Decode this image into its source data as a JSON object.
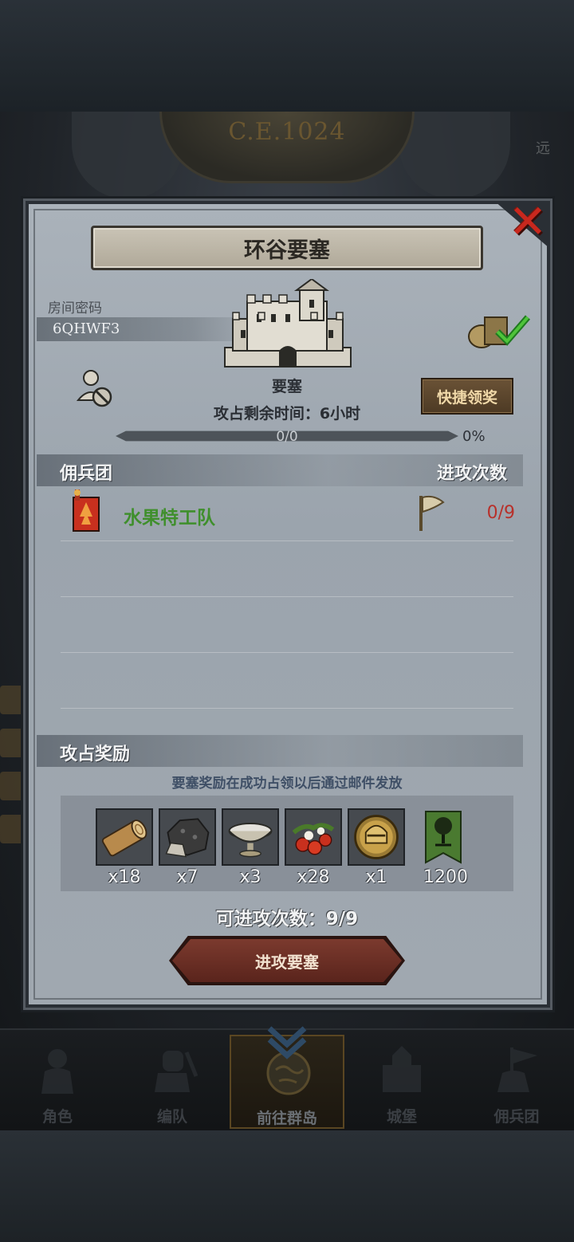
{
  "background": {
    "year_label": "C.E.1024",
    "right_edge_text": "远"
  },
  "dialog": {
    "title": "环谷要塞",
    "room_label": "房间密码",
    "room_code": "6QHWF3",
    "fortress_label": "要塞",
    "quick_claim_label": "快捷领奖",
    "time_left_text": "攻占剩余时间：6小时",
    "progress": {
      "count_text": "0/0",
      "percent_text": "0%",
      "fraction": 0
    },
    "mercenary_header": "佣兵团",
    "attack_count_header": "进攻次数",
    "mercenary_rows": [
      {
        "name": "水果特工队",
        "attacks": "0/9"
      }
    ],
    "rewards_header": "攻占奖励",
    "reward_note": "要塞奖励在成功占领以后通过邮件发放",
    "rewards": [
      {
        "icon": "wood-log-icon",
        "qty": "x18"
      },
      {
        "icon": "ore-stone-icon",
        "qty": "x7"
      },
      {
        "icon": "silver-bowl-icon",
        "qty": "x3"
      },
      {
        "icon": "berries-icon",
        "qty": "x28"
      },
      {
        "icon": "knight-helmet-coin-icon",
        "qty": "x1"
      },
      {
        "icon": "tree-banner-icon",
        "qty": "1200"
      }
    ],
    "attacks_available_text": "可进攻次数：9/9",
    "attack_button_label": "进攻要塞"
  },
  "bottom_nav": [
    {
      "label": "角色",
      "icon": "knight-icon",
      "active": false
    },
    {
      "label": "编队",
      "icon": "formation-icon",
      "active": false
    },
    {
      "label": "前往群岛",
      "icon": "globe-icon",
      "active": true
    },
    {
      "label": "城堡",
      "icon": "castle-icon",
      "active": false
    },
    {
      "label": "佣兵团",
      "icon": "mercenary-icon",
      "active": false
    }
  ],
  "colors": {
    "close_red": "#c8281e",
    "guild_green": "#3f8f2c",
    "attack_count_red": "#b8302a",
    "button_brown": "#5a241c"
  }
}
